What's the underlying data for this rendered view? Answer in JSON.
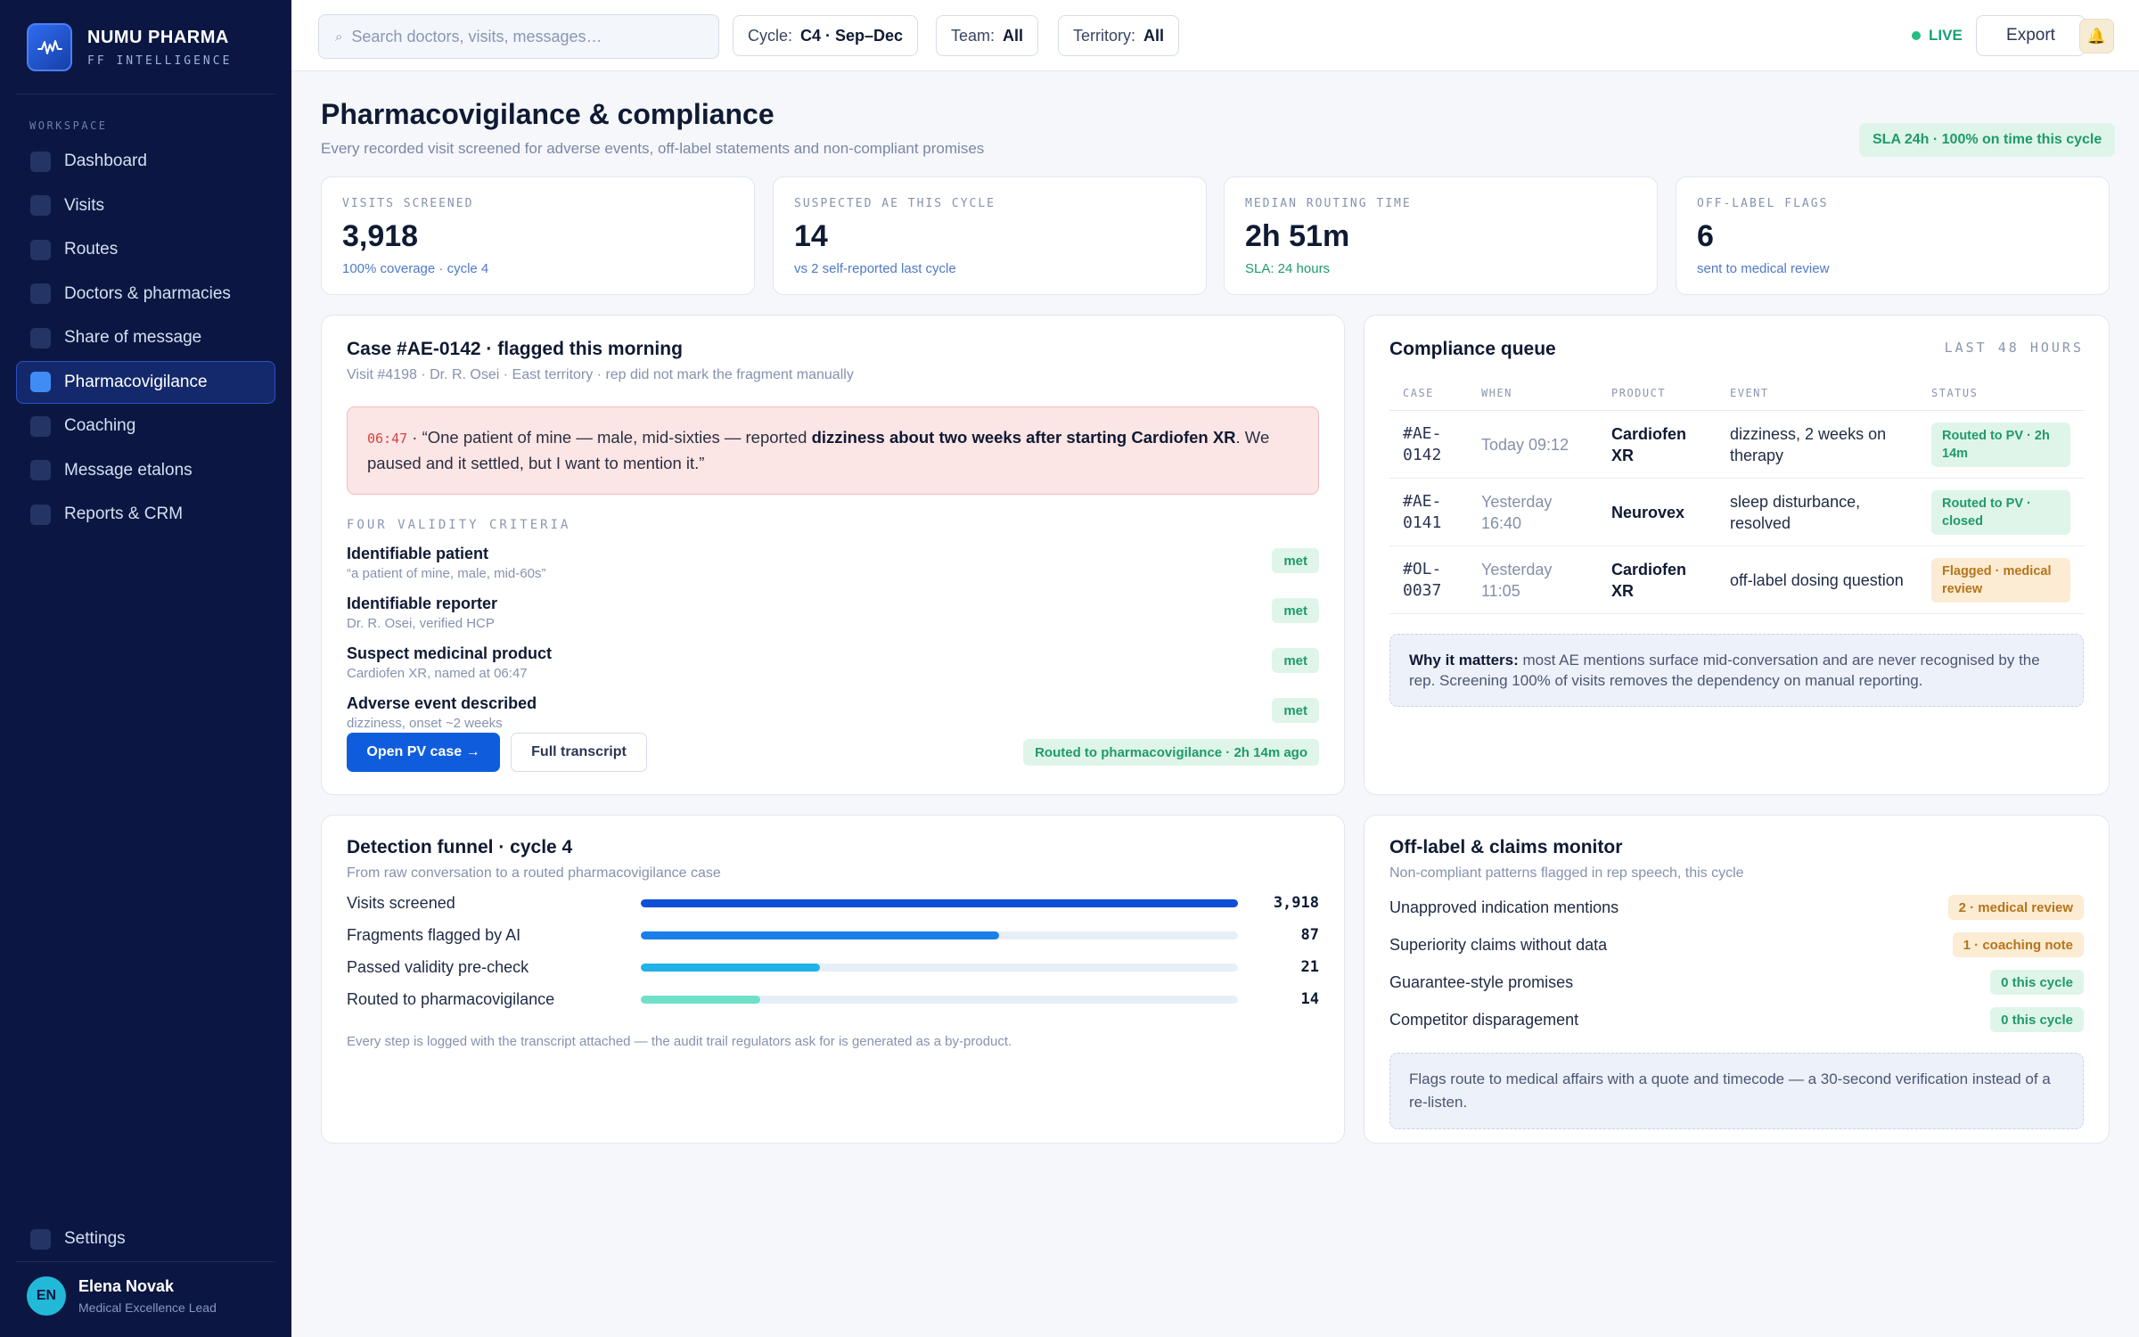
{
  "brand": {
    "name": "NUMU PHARMA",
    "sub": "FF INTELLIGENCE"
  },
  "sidebar": {
    "section": "WORKSPACE",
    "items": [
      {
        "label": "Dashboard"
      },
      {
        "label": "Visits"
      },
      {
        "label": "Routes"
      },
      {
        "label": "Doctors & pharmacies"
      },
      {
        "label": "Share of message"
      },
      {
        "label": "Pharmacovigilance",
        "active": true
      },
      {
        "label": "Coaching"
      },
      {
        "label": "Message etalons"
      },
      {
        "label": "Reports & CRM"
      }
    ],
    "settings": "Settings",
    "user": {
      "initials": "EN",
      "name": "Elena Novak",
      "role": "Medical Excellence Lead"
    }
  },
  "topbar": {
    "search_placeholder": "Search doctors, visits, messages…",
    "search_icon": "⌕",
    "filters": [
      {
        "label": "Cycle:",
        "value": "C4 · Sep–Dec"
      },
      {
        "label": "Team:",
        "value": "All"
      },
      {
        "label": "Territory:",
        "value": "All"
      }
    ],
    "live": "LIVE",
    "export": "Export",
    "bell_icon": "🔔"
  },
  "header": {
    "title": "Pharmacovigilance & compliance",
    "subtitle": "Every recorded visit screened for adverse events, off-label statements and non-compliant promises",
    "sla_badge": "SLA 24h · 100% on time this cycle"
  },
  "kpis": [
    {
      "label": "VISITS SCREENED",
      "value": "3,918",
      "note": "100% coverage · cycle 4"
    },
    {
      "label": "SUSPECTED AE THIS CYCLE",
      "value": "14",
      "note": "vs 2 self-reported last cycle"
    },
    {
      "label": "MEDIAN ROUTING TIME",
      "value": "2h 51m",
      "note": "SLA: 24 hours"
    },
    {
      "label": "OFF-LABEL FLAGS",
      "value": "6",
      "note": "sent to medical review"
    }
  ],
  "case": {
    "title": "Case #AE-0142 · flagged this morning",
    "subtitle": "Visit #4198 · Dr. R. Osei · East territory · rep did not mark the fragment manually",
    "quote_time": "06:47",
    "quote_pre": " · “One patient of mine — male, mid-sixties — reported ",
    "quote_bold": "dizziness about two weeks after starting Cardiofen XR",
    "quote_post": ". We paused and it settled, but I want to mention it.”",
    "criteria_head": "FOUR VALIDITY CRITERIA",
    "criteria": [
      {
        "name": "Identifiable patient",
        "desc": "“a patient of mine, male, mid-60s”",
        "status": "met"
      },
      {
        "name": "Identifiable reporter",
        "desc": "Dr. R. Osei, verified HCP",
        "status": "met"
      },
      {
        "name": "Suspect medicinal product",
        "desc": "Cardiofen XR, named at 06:47",
        "status": "met"
      },
      {
        "name": "Adverse event described",
        "desc": "dizziness, onset ~2 weeks",
        "status": "met"
      }
    ],
    "open_button": "Open PV case →",
    "transcript_button": "Full transcript",
    "routed": "Routed to pharmacovigilance · 2h 14m ago"
  },
  "queue": {
    "title": "Compliance queue",
    "range": "LAST 48 HOURS",
    "columns": [
      "CASE",
      "WHEN",
      "PRODUCT",
      "EVENT",
      "STATUS"
    ],
    "rows": [
      {
        "case": "#AE-0142",
        "when": "Today 09:12",
        "product": "Cardiofen XR",
        "event": "dizziness, 2 weeks on therapy",
        "status": "Routed to PV · 2h 14m",
        "tone": "green"
      },
      {
        "case": "#AE-0141",
        "when": "Yesterday 16:40",
        "product": "Neurovex",
        "event": "sleep disturbance, resolved",
        "status": "Routed to PV · closed",
        "tone": "green"
      },
      {
        "case": "#OL-0037",
        "when": "Yesterday 11:05",
        "product": "Cardiofen XR",
        "event": "off-label dosing question",
        "status": "Flagged · medical review",
        "tone": "amber"
      }
    ],
    "why_bold": "Why it matters:",
    "why_text": " most AE mentions surface mid-conversation and are never recognised by the rep. Screening 100% of visits removes the dependency on manual reporting."
  },
  "funnel": {
    "title": "Detection funnel · cycle 4",
    "subtitle": "From raw conversation to a routed pharmacovigilance case",
    "steps": [
      {
        "label": "Visits screened",
        "value": "3,918",
        "fraction": 1.0,
        "color": "#0f4fd6"
      },
      {
        "label": "Fragments flagged by AI",
        "value": "87",
        "fraction": 0.6,
        "color": "#1a7fe8"
      },
      {
        "label": "Passed validity pre-check",
        "value": "21",
        "fraction": 0.3,
        "color": "#20b2e8"
      },
      {
        "label": "Routed to pharmacovigilance",
        "value": "14",
        "fraction": 0.2,
        "color": "#6fe0c9"
      }
    ],
    "footnote": "Every step is logged with the transcript attached — the audit trail regulators ask for is generated as a by-product."
  },
  "offlabel": {
    "title": "Off-label & claims monitor",
    "subtitle": "Non-compliant patterns flagged in rep speech, this cycle",
    "rows": [
      {
        "label": "Unapproved indication mentions",
        "tag": "2 · medical review",
        "tone": "amber"
      },
      {
        "label": "Superiority claims without data",
        "tag": "1 · coaching note",
        "tone": "amber"
      },
      {
        "label": "Guarantee-style promises",
        "tag": "0 this cycle",
        "tone": "green"
      },
      {
        "label": "Competitor disparagement",
        "tag": "0 this cycle",
        "tone": "green"
      }
    ],
    "note": "Flags route to medical affairs with a quote and timecode — a 30-second verification instead of a re-listen."
  }
}
